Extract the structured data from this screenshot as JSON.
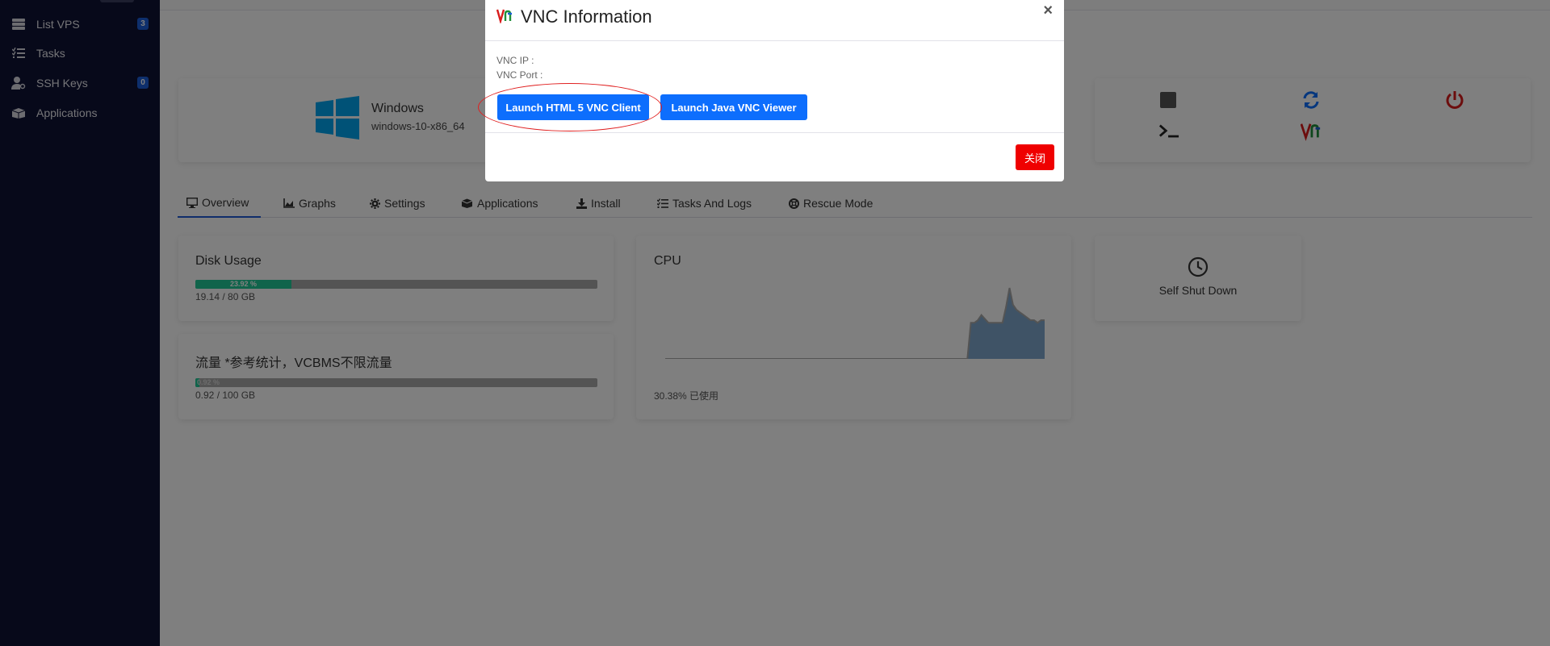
{
  "sidebar": {
    "items": [
      {
        "label": "List VPS",
        "badge": "3",
        "icon": "server-icon"
      },
      {
        "label": "Tasks",
        "badge": "",
        "icon": "tasks-icon"
      },
      {
        "label": "SSH Keys",
        "badge": "0",
        "icon": "user-key-icon"
      },
      {
        "label": "Applications",
        "badge": "",
        "icon": "box-icon"
      }
    ]
  },
  "vps": {
    "os_name": "Windows",
    "os_template": "windows-10-x86_64"
  },
  "tabs": [
    {
      "label": "Overview",
      "icon": "monitor-icon",
      "active": true
    },
    {
      "label": "Graphs",
      "icon": "chart-icon",
      "active": false
    },
    {
      "label": "Settings",
      "icon": "gear-icon",
      "active": false
    },
    {
      "label": "Applications",
      "icon": "box-icon",
      "active": false
    },
    {
      "label": "Install",
      "icon": "download-icon",
      "active": false
    },
    {
      "label": "Tasks And Logs",
      "icon": "tasks-icon",
      "active": false
    },
    {
      "label": "Rescue Mode",
      "icon": "lifebuoy-icon",
      "active": false
    }
  ],
  "disk": {
    "title": "Disk Usage",
    "percent_label": "23.92 %",
    "percent": 23.92,
    "usage": "19.14 / 80 GB"
  },
  "traffic": {
    "title": "流量   *参考统计，VCBMS不限流量",
    "percent_label": "0.92 %",
    "percent": 0.92,
    "usage": "0.92 / 100 GB"
  },
  "cpu": {
    "title": "CPU",
    "usage_label": "30.38% 已使用"
  },
  "shutdown": {
    "label": "Self Shut Down"
  },
  "chart_data": {
    "type": "area",
    "title": "CPU",
    "series": [
      {
        "values": [
          0,
          0,
          0,
          0,
          0,
          0,
          0,
          0,
          0,
          0,
          0,
          0,
          0,
          0,
          0,
          0,
          0,
          0,
          0,
          0,
          0,
          0,
          0,
          0,
          0,
          0,
          0,
          0,
          0,
          0,
          0,
          0,
          0,
          0,
          0,
          0,
          0,
          0,
          0,
          0,
          0,
          0,
          0,
          0,
          0,
          0,
          0,
          0,
          0,
          0,
          0,
          0,
          0,
          0,
          0,
          0,
          0,
          0,
          0,
          0,
          0,
          0,
          0,
          0,
          0,
          0,
          0,
          0,
          0,
          0,
          0,
          0,
          0,
          0,
          0,
          0,
          0,
          0,
          0,
          0,
          0,
          0,
          0,
          0,
          0,
          0,
          0,
          28,
          28,
          30,
          34,
          31,
          28,
          28,
          28,
          28,
          28,
          40,
          55,
          42,
          38,
          36,
          34,
          32,
          30,
          30,
          28,
          30,
          30
        ]
      }
    ],
    "grid": false,
    "legend": "none"
  },
  "modal": {
    "title": "VNC Information",
    "vnc_ip_label": "VNC IP :",
    "vnc_port_label": "VNC Port :",
    "html5_button": "Launch HTML 5 VNC Client",
    "java_button": "Launch Java VNC Viewer",
    "close_button": "关闭",
    "close_x": "×"
  },
  "colors": {
    "sidebar_bg": "#0e1235",
    "primary": "#0d6efd",
    "danger": "#ef0000",
    "success": "#20c997",
    "windows_blue": "#00a4ef"
  }
}
